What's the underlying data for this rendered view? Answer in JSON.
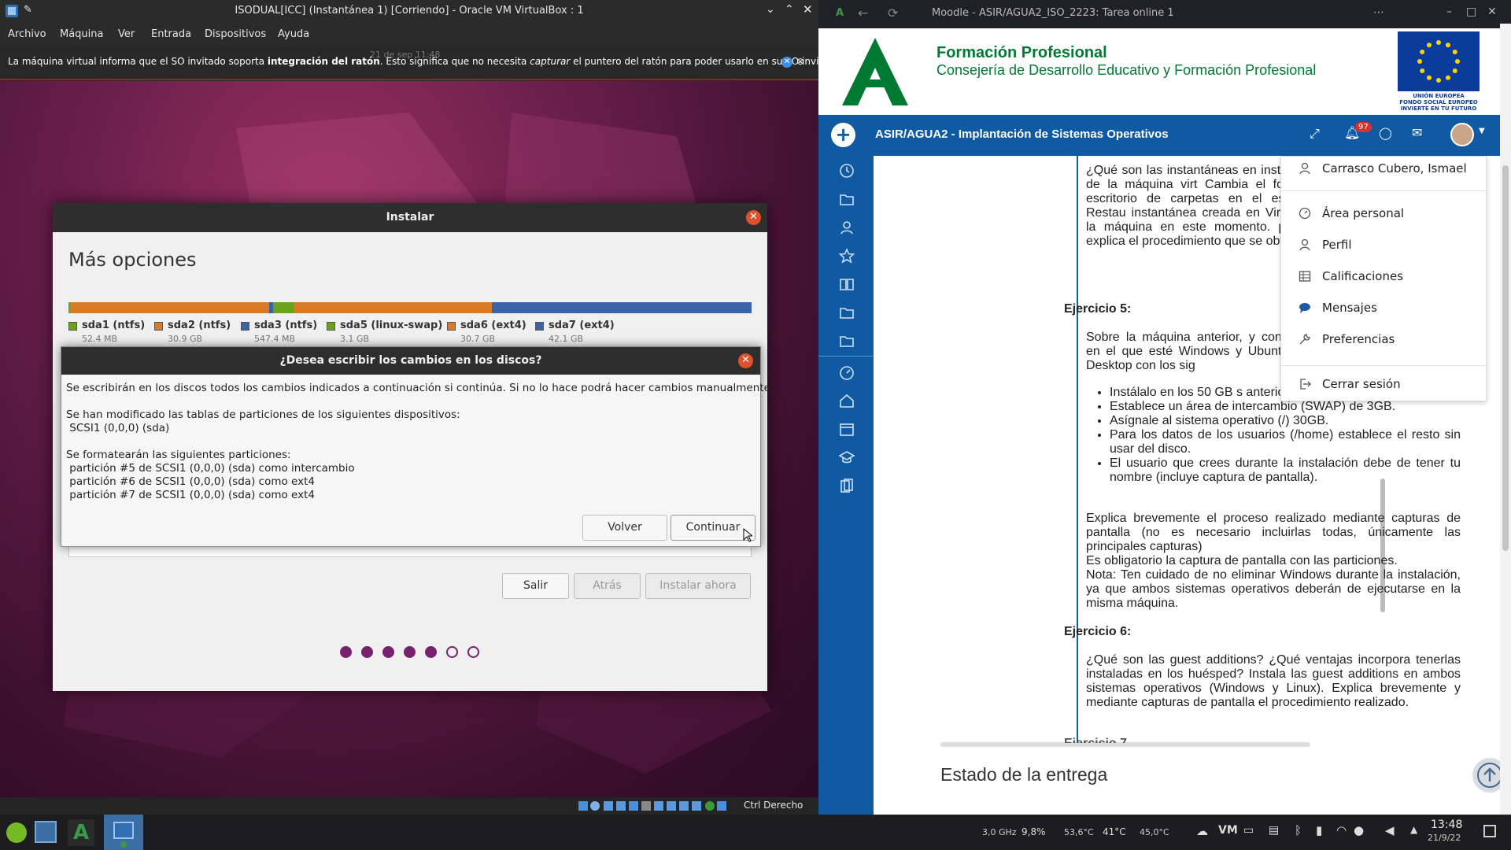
{
  "vbox": {
    "title": "ISODUAL[ICC] (Instantánea 1) [Corriendo] - Oracle VM VirtualBox : 1",
    "menu": [
      "Archivo",
      "Máquina",
      "Ver",
      "Entrada",
      "Dispositivos",
      "Ayuda"
    ],
    "info_before": "La máquina virtual informa que el SO invitado soporta ",
    "info_bold": "integración del ratón",
    "info_mid": ". Esto significa que no necesita ",
    "info_italic": "capturar",
    "info_after": " el puntero del ratón para poder usarlo en su SO invitado",
    "status_host_key": "Ctrl Derecho",
    "guest_clock": "21 de sep  11:48"
  },
  "installer": {
    "title": "Instalar",
    "heading": "Más opciones",
    "partitions": [
      {
        "name": "sda1 (ntfs)",
        "size": "52.4 MB",
        "color": "#6aa121"
      },
      {
        "name": "sda2 (ntfs)",
        "size": "30.9 GB",
        "color": "#d77b28"
      },
      {
        "name": "sda3 (ntfs)",
        "size": "547.4 MB",
        "color": "#3a63a8"
      },
      {
        "name": "sda5 (linux-swap)",
        "size": "3.1 GB",
        "color": "#6aa121"
      },
      {
        "name": "sda6 (ext4)",
        "size": "30.7 GB",
        "color": "#d77b28"
      },
      {
        "name": "sda7 (ext4)",
        "size": "42.1 GB",
        "color": "#3a63a8"
      }
    ],
    "buttons": {
      "quit": "Salir",
      "back": "Atrás",
      "install": "Instalar ahora"
    },
    "progress_steps_total": 7,
    "progress_steps_done": 5
  },
  "dialog": {
    "title": "¿Desea escribir los cambios en los discos?",
    "body": "Se escribirán en los discos todos los cambios indicados a continuación si continúa. Si no lo hace podrá hacer cambios manualmente.\n\nSe han modificado las tablas de particiones de los siguientes dispositivos:\n SCSI1 (0,0,0) (sda)\n\nSe formatearán las siguientes particiones:\n partición #5 de SCSI1 (0,0,0) (sda) como intercambio\n partición #6 de SCSI1 (0,0,0) (sda) como ext4\n partición #7 de SCSI1 (0,0,0) (sda) como ext4",
    "back_label": "Volver",
    "continue_label": "Continuar"
  },
  "browser": {
    "tab_title": "Moodle - ASIR/AGUA2_ISO_2223: Tarea online 1",
    "banner_line1": "Formación Profesional",
    "banner_line2": "Consejería de Desarrollo Educativo y Formación Profesional",
    "eu_line1": "UNIÓN EUROPEA",
    "eu_line2": "FONDO SOCIAL EUROPEO",
    "eu_line3": "INVIERTE EN TU FUTURO",
    "course_title": "ASIR/AGUA2 - Implantación de Sistemas Operativos",
    "notification_count": "97",
    "q4_text": "¿Qué son las instantáneas en instantánea de la máquina virt Cambia el fondo de escritorio de carpetas en el escritorio. Restau instantánea creada en VirtualBox. la máquina en este momento. pantalla, explica el procedimiento que se obtiene.",
    "ex5_title": "Ejercicio 5:",
    "ex5_intro": "Sobre la máquina anterior, y con equipo en el que esté Windows y Ubuntu 20.04 Desktop con los sig",
    "ex5_items": [
      "Instálalo en los 50 GB s anterior.",
      "Establece un área de intercambio (SWAP) de 3GB.",
      "Asígnale al sistema operativo (/) 30GB.",
      "Para los datos de los usuarios (/home) establece el resto sin usar del disco.",
      "El usuario que crees durante la instalación debe de tener tu nombre (incluye captura de pantalla)."
    ],
    "ex5_explain": "Explica brevemente el proceso realizado mediante capturas de pantalla (no es necesario incluirlas todas, únicamente las principales capturas)",
    "ex5_mandatory": "Es obligatorio la captura de pantalla con las particiones.",
    "ex5_note": "Nota: Ten cuidado de no eliminar Windows durante la instalación, ya que ambos sistemas operativos deberán de ejecutarse en la misma máquina.",
    "ex6_title": "Ejercicio 6:",
    "ex6_text": "¿Qué son las guest additions?  ¿Qué ventajas incorpora tenerlas instaladas en los huésped?  Instala las guest additions en ambos sistemas operativos (Windows y Linux). Explica brevemente y mediante capturas de pantalla el procedimiento realizado.",
    "ex7_partial": "Ejercicio 7",
    "section_heading": "Estado de la entrega",
    "user_menu": {
      "user_name": "Carrasco Cubero, Ismael",
      "items": [
        "Área personal",
        "Perfil",
        "Calificaciones",
        "Mensajes",
        "Preferencias"
      ],
      "logout": "Cerrar sesión"
    }
  },
  "taskbar": {
    "cpu_freq": "3,0 GHz",
    "cpu_load": "9,8%",
    "temp1": "53,6°C",
    "temp2": "41°C",
    "temp3": "45,0°C",
    "time": "13:48",
    "date": "21/9/22"
  },
  "colors": {
    "accent_blue": "#0f5aa3",
    "junta_green": "#007a33",
    "ubuntu_purple": "#77216f",
    "close_orange": "#e0502a"
  }
}
